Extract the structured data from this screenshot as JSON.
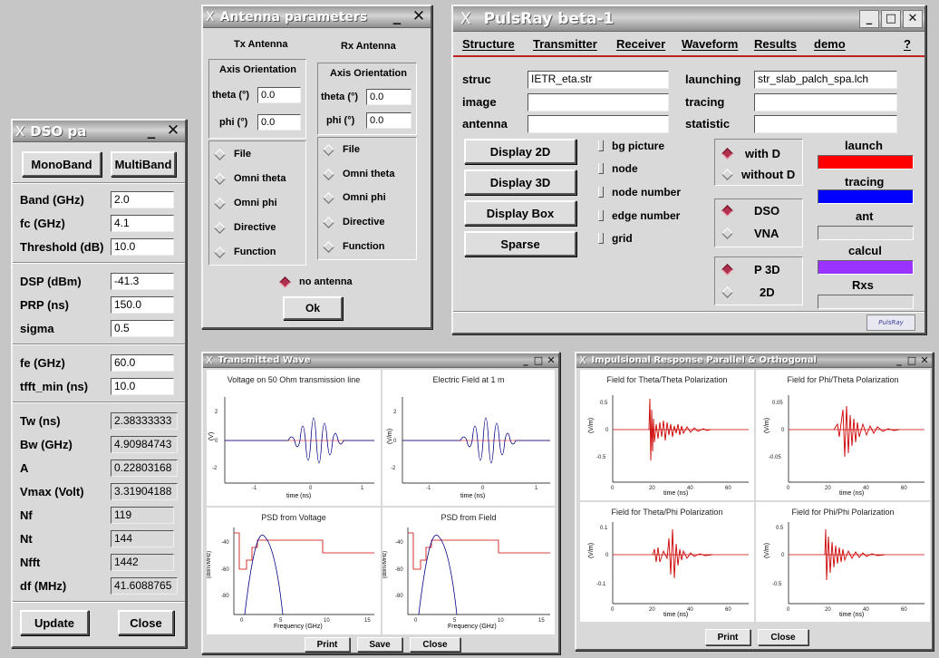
{
  "dso": {
    "title": "DSO pa",
    "mono": "MonoBand",
    "multi": "MultiBand",
    "band_l": "Band (GHz)",
    "band_v": "2.0",
    "fc_l": "fc (GHz)",
    "fc_v": "4.1",
    "thr_l": "Threshold (dB)",
    "thr_v": "10.0",
    "dsp_l": "DSP (dBm)",
    "dsp_v": "-41.3",
    "prp_l": "PRP (ns)",
    "prp_v": "150.0",
    "sig_l": "sigma",
    "sig_v": "0.5",
    "fe_l": "fe (GHz)",
    "fe_v": "60.0",
    "tf_l": "tfft_min (ns)",
    "tf_v": "10.0",
    "tw_l": "Tw (ns)",
    "tw_v": "2.38333333",
    "bw_l": "Bw (GHz)",
    "bw_v": "4.90984743",
    "a_l": "A",
    "a_v": "0.22803168",
    "vm_l": "Vmax (Volt)",
    "vm_v": "3.31904188",
    "nf_l": "Nf",
    "nf_v": "119",
    "nt_l": "Nt",
    "nt_v": "144",
    "nfft_l": "Nfft",
    "nfft_v": "1442",
    "df_l": "df (MHz)",
    "df_v": "41.6088765",
    "update": "Update",
    "close": "Close"
  },
  "ant": {
    "title": "Antenna parameters",
    "tx": "Tx Antenna",
    "rx": "Rx Antenna",
    "axis": "Axis Orientation",
    "theta": "theta (°)",
    "phi": "phi (°)",
    "tx_theta": "0.0",
    "tx_phi": "0.0",
    "rx_theta": "0.0",
    "rx_phi": "0.0",
    "file": "File",
    "omni_theta": "Omni theta",
    "omni_phi": "Omni phi",
    "directive": "Directive",
    "function": "Function",
    "none": "no antenna",
    "ok": "Ok"
  },
  "pr": {
    "title": "PulsRay beta-1",
    "menu": {
      "structure": "Structure",
      "transmitter": "Transmitter",
      "receiver": "Receiver",
      "waveform": "Waveform",
      "results": "Results",
      "demo": "demo",
      "help": "?"
    },
    "struc_l": "struc",
    "struc_v": "IETR_eta.str",
    "image_l": "image",
    "antenna_l": "antenna",
    "launching_l": "launching",
    "launching_v": "str_slab_palch_spa.lch",
    "tracing_l": "tracing",
    "statistic_l": "statistic",
    "d2": "Display 2D",
    "d3": "Display 3D",
    "dbox": "Display Box",
    "sparse": "Sparse",
    "bg": "bg picture",
    "node": "node",
    "nodenum": "node number",
    "edge": "edge number",
    "grid": "grid",
    "withd": "with D",
    "withoutd": "without D",
    "dso": "DSO",
    "vna": "VNA",
    "p3d": "P 3D",
    "d2r": "2D",
    "launch": "launch",
    "tracing": "tracing",
    "antl": "ant",
    "calcul": "calcul",
    "rxs": "Rxs",
    "logo": "PulsRay",
    "colors": {
      "launch": "#ff0000",
      "tracing": "#0000ff",
      "calcul": "#9a33ff"
    }
  },
  "tw": {
    "title": "Transmitted Wave",
    "print": "Print",
    "save": "Save",
    "close": "Close",
    "p1": "Voltage on 50 Ohm transmission line",
    "p2": "Electric Field at 1 m",
    "p3": "PSD from Voltage",
    "p4": "PSD from Field",
    "time": "time (ns)",
    "freq": "Frequency (GHz)",
    "yv": "(V)",
    "yvm": "(V/m)",
    "ydb": "(dBm/MHz)"
  },
  "ir": {
    "title": "Impulsional Response Parallel & Orthogonal",
    "print": "Print",
    "close": "Close",
    "p1": "Field for Theta/Theta Polarization",
    "p2": "Field for Phi/Theta Polarization",
    "p3": "Field for Theta/Phi Polarization",
    "p4": "Field for Phi/Phi Polarization",
    "time": "time (ns)",
    "yvm": "(V/m)"
  },
  "icons": {
    "close": "close-icon",
    "minimize": "minimize-icon",
    "maximize": "maximize-icon",
    "x": "x-logo-icon"
  }
}
